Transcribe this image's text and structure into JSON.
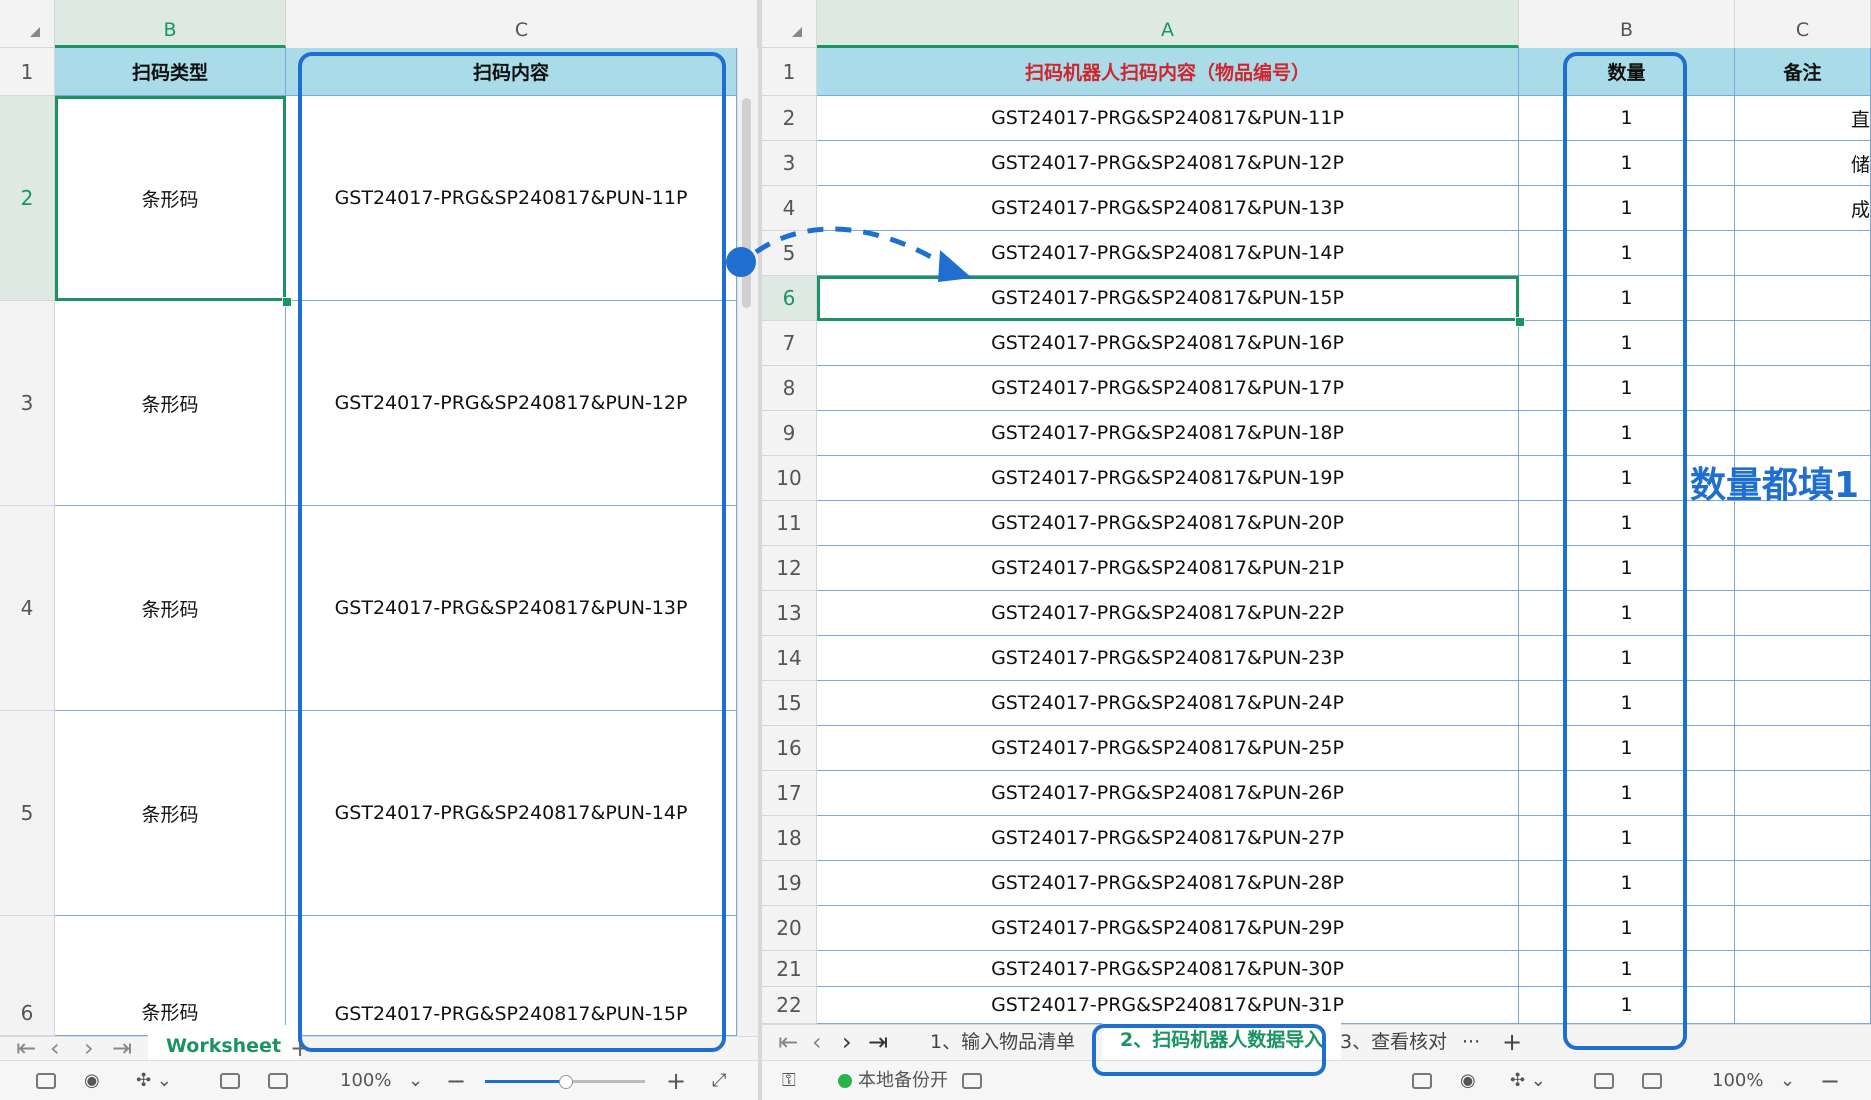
{
  "left": {
    "columns": [
      "B",
      "C"
    ],
    "header_row": {
      "row": "1",
      "b": "扫码类型",
      "c": "扫码内容"
    },
    "rows": [
      {
        "row": "2",
        "b": "条形码",
        "c": "GST24017-PRG&SP240817&PUN-11P"
      },
      {
        "row": "3",
        "b": "条形码",
        "c": "GST24017-PRG&SP240817&PUN-12P"
      },
      {
        "row": "4",
        "b": "条形码",
        "c": "GST24017-PRG&SP240817&PUN-13P"
      },
      {
        "row": "5",
        "b": "条形码",
        "c": "GST24017-PRG&SP240817&PUN-14P"
      },
      {
        "row": "6",
        "b": "条形码",
        "c": "GST24017-PRG&SP240817&PUN-15P"
      }
    ],
    "sheet_tab": "Worksheet",
    "zoom": "100%",
    "zoom_fraction": 0.5
  },
  "right": {
    "columns": [
      "A",
      "B",
      "C"
    ],
    "header_row": {
      "row": "1",
      "a": "扫码机器人扫码内容（物品编号）",
      "b": "数量",
      "c": "备注"
    },
    "rows": [
      {
        "row": "2",
        "a": "GST24017-PRG&SP240817&PUN-11P",
        "b": "1",
        "c_edge": "直"
      },
      {
        "row": "3",
        "a": "GST24017-PRG&SP240817&PUN-12P",
        "b": "1",
        "c_edge": "储"
      },
      {
        "row": "4",
        "a": "GST24017-PRG&SP240817&PUN-13P",
        "b": "1",
        "c_edge": "成"
      },
      {
        "row": "5",
        "a": "GST24017-PRG&SP240817&PUN-14P",
        "b": "1",
        "c_edge": ""
      },
      {
        "row": "6",
        "a": "GST24017-PRG&SP240817&PUN-15P",
        "b": "1",
        "c_edge": ""
      },
      {
        "row": "7",
        "a": "GST24017-PRG&SP240817&PUN-16P",
        "b": "1",
        "c_edge": ""
      },
      {
        "row": "8",
        "a": "GST24017-PRG&SP240817&PUN-17P",
        "b": "1",
        "c_edge": ""
      },
      {
        "row": "9",
        "a": "GST24017-PRG&SP240817&PUN-18P",
        "b": "1",
        "c_edge": ""
      },
      {
        "row": "10",
        "a": "GST24017-PRG&SP240817&PUN-19P",
        "b": "1",
        "c_edge": ""
      },
      {
        "row": "11",
        "a": "GST24017-PRG&SP240817&PUN-20P",
        "b": "1",
        "c_edge": ""
      },
      {
        "row": "12",
        "a": "GST24017-PRG&SP240817&PUN-21P",
        "b": "1",
        "c_edge": ""
      },
      {
        "row": "13",
        "a": "GST24017-PRG&SP240817&PUN-22P",
        "b": "1",
        "c_edge": ""
      },
      {
        "row": "14",
        "a": "GST24017-PRG&SP240817&PUN-23P",
        "b": "1",
        "c_edge": ""
      },
      {
        "row": "15",
        "a": "GST24017-PRG&SP240817&PUN-24P",
        "b": "1",
        "c_edge": ""
      },
      {
        "row": "16",
        "a": "GST24017-PRG&SP240817&PUN-25P",
        "b": "1",
        "c_edge": ""
      },
      {
        "row": "17",
        "a": "GST24017-PRG&SP240817&PUN-26P",
        "b": "1",
        "c_edge": ""
      },
      {
        "row": "18",
        "a": "GST24017-PRG&SP240817&PUN-27P",
        "b": "1",
        "c_edge": ""
      },
      {
        "row": "19",
        "a": "GST24017-PRG&SP240817&PUN-28P",
        "b": "1",
        "c_edge": ""
      },
      {
        "row": "20",
        "a": "GST24017-PRG&SP240817&PUN-29P",
        "b": "1",
        "c_edge": ""
      },
      {
        "row": "21",
        "a": "GST24017-PRG&SP240817&PUN-30P",
        "b": "1",
        "c_edge": ""
      },
      {
        "row": "22",
        "a": "GST24017-PRG&SP240817&PUN-31P",
        "b": "1",
        "c_edge": ""
      }
    ],
    "sheet_tabs": [
      "1、输入物品清单",
      "2、扫码机器人数据导入",
      "3、查看核对"
    ],
    "more_tabs": "···",
    "backup_status": "本地备份开",
    "zoom": "100%"
  },
  "annotation": "数量都填1",
  "colors": {
    "header_fill": "#a9dbe9",
    "accent_green": "#1a9462",
    "annot_blue": "#1f6fd1",
    "title_red": "#d0252c"
  }
}
